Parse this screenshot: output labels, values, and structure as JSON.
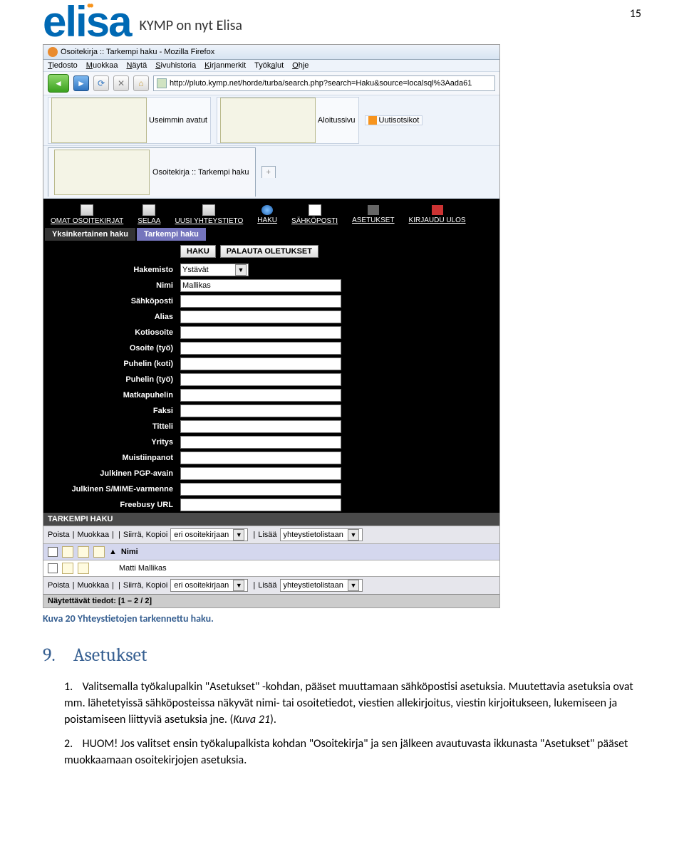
{
  "page_number": "15",
  "brand": {
    "logo": "elisa",
    "sub": "KYMP on nyt Elisa"
  },
  "browser": {
    "title": "Osoitekirja :: Tarkempi haku - Mozilla Firefox",
    "menu": [
      "Tiedosto",
      "Muokkaa",
      "Näytä",
      "Sivuhistoria",
      "Kirjanmerkit",
      "Työkalut",
      "Ohje"
    ],
    "url": "http://pluto.kymp.net/horde/turba/search.php?search=Haku&source=localsql%3Aada61",
    "bookmarks": [
      "Useimmin avatut",
      "Aloitussivu",
      "Uutisotsikot"
    ],
    "tab": "Osoitekirja :: Tarkempi haku"
  },
  "horde": {
    "nav": [
      "OMAT OSOITEKIRJAT",
      "SELAA",
      "UUSI YHTEYSTIETO",
      "HAKU",
      "SÄHKÖPOSTI",
      "ASETUKSET",
      "KIRJAUDU ULOS"
    ],
    "tabs": {
      "inactive": "Yksinkertainen haku",
      "active": "Tarkempi haku"
    },
    "actions": {
      "search": "HAKU",
      "reset": "PALAUTA OLETUKSET"
    },
    "fields": {
      "hakemisto_label": "Hakemisto",
      "hakemisto_value": "Ystävät",
      "nimi_label": "Nimi",
      "nimi_value": "Mallikas",
      "sahkoposti_label": "Sähköposti",
      "alias_label": "Alias",
      "kotiosoite_label": "Kotiosoite",
      "osoite_tyo_label": "Osoite (työ)",
      "puhelin_koti_label": "Puhelin (koti)",
      "puhelin_tyo_label": "Puhelin (työ)",
      "matkapuhelin_label": "Matkapuhelin",
      "faksi_label": "Faksi",
      "titteli_label": "Titteli",
      "yritys_label": "Yritys",
      "muistiinpanot_label": "Muistiinpanot",
      "pgp_label": "Julkinen PGP-avain",
      "smime_label": "Julkinen S/MIME-varmenne",
      "freebusy_label": "Freebusy URL"
    },
    "results": {
      "header": "TARKEMPI HAKU",
      "bar_poista": "Poista",
      "bar_muokkaa": "Muokkaa",
      "bar_siirra": "Siirrä, Kopioi",
      "bar_sel1": "eri osoitekirjaan",
      "bar_lisaa": "Lisää",
      "bar_sel2": "yhteystietolistaan",
      "col_nimi": "Nimi",
      "row1": "Matti Mallikas",
      "footer": "Näytettävät tiedot: [1 – 2 / 2]"
    }
  },
  "caption": "Kuva 20 Yhteystietojen tarkennettu haku.",
  "section_heading": "9. Asetukset",
  "body": {
    "p1a": "Valitsemalla työkalupalkin \"Asetukset\" -kohdan, pääset muuttamaan sähköpostisi asetuksia. Muutettavia asetuksia ovat mm. lähetetyissä sähköposteissa näkyvät nimi- tai osoitetiedot, viestien allekirjoitus, viestin kirjoitukseen, lukemiseen ja poistamiseen liittyviä asetuksia jne. (",
    "p1b": "Kuva 21",
    "p1c": ").",
    "p2": "HUOM! Jos valitset ensin työkalupalkista kohdan \"Osoitekirja\" ja sen jälkeen avautuvasta ikkunasta \"Asetukset\" pääset muokkaamaan osoitekirjojen asetuksia."
  }
}
